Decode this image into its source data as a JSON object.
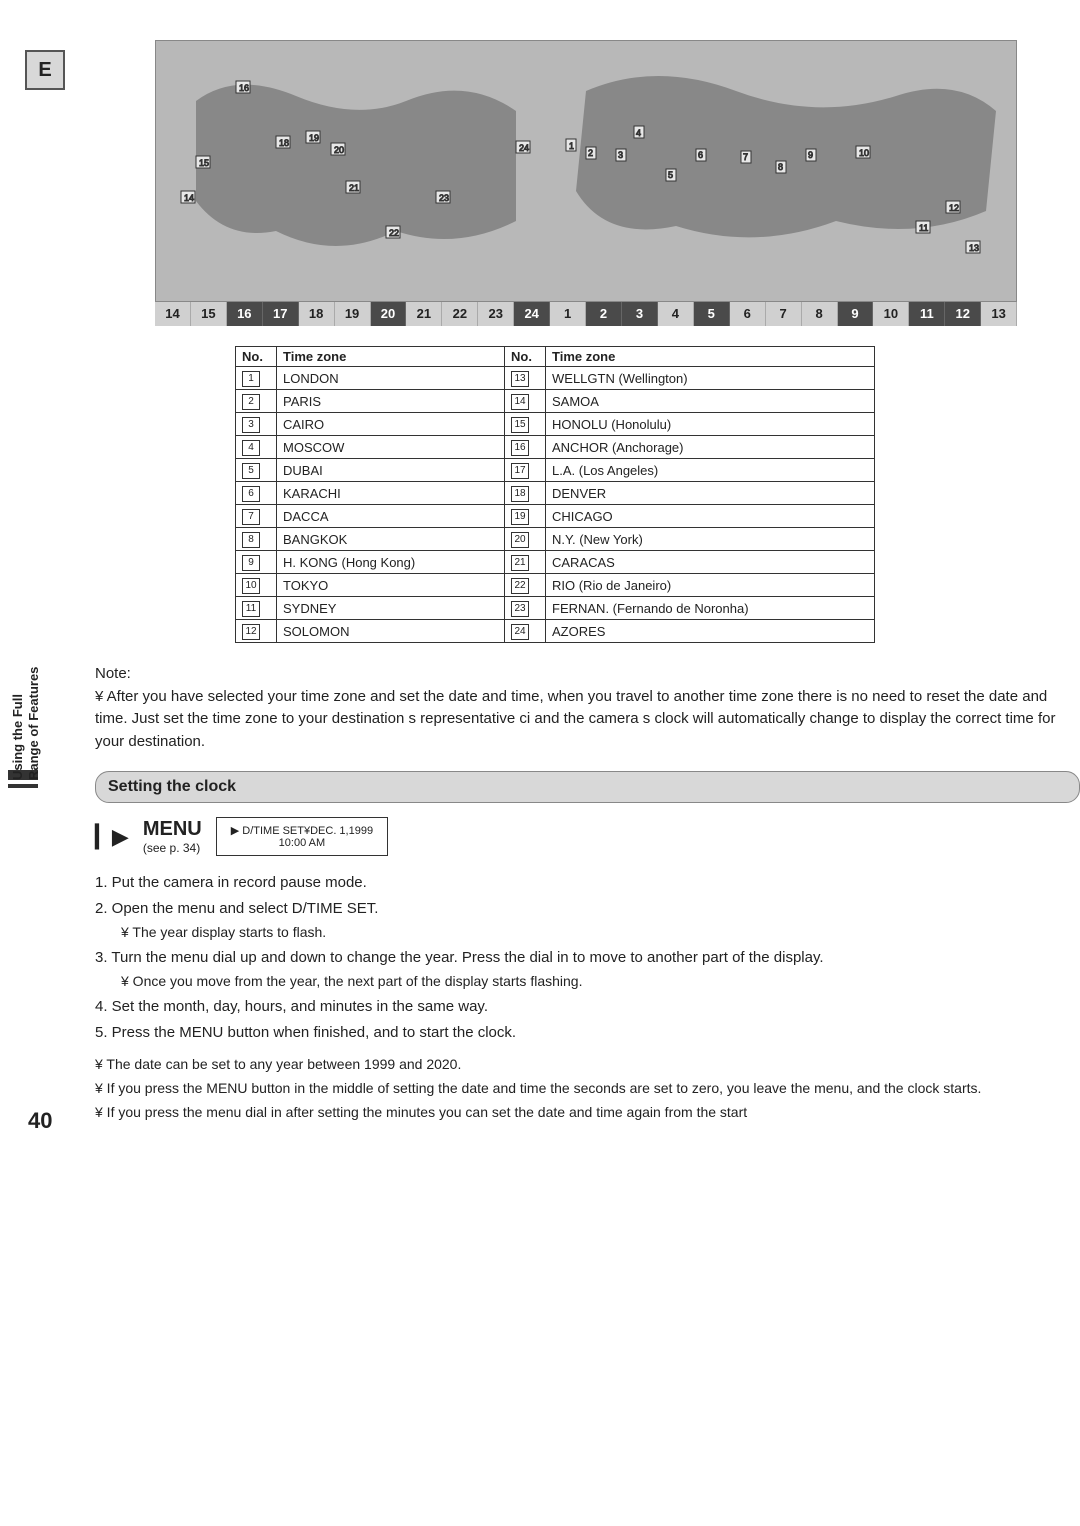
{
  "side_tab": "E",
  "side_label_line1": "Using the Full",
  "side_label_line2": "Range of Features",
  "time_strip": [
    "14",
    "15",
    "16",
    "17",
    "18",
    "19",
    "20",
    "21",
    "22",
    "23",
    "24",
    "1",
    "2",
    "3",
    "4",
    "5",
    "6",
    "7",
    "8",
    "9",
    "10",
    "11",
    "12",
    "13"
  ],
  "time_strip_dark": [
    2,
    3,
    6,
    10,
    12,
    13,
    15,
    19,
    21,
    22
  ],
  "tz_header": {
    "no": "No.",
    "zone": "Time zone"
  },
  "timezones_left": [
    {
      "n": "1",
      "name": "LONDON"
    },
    {
      "n": "2",
      "name": "PARIS"
    },
    {
      "n": "3",
      "name": "CAIRO"
    },
    {
      "n": "4",
      "name": "MOSCOW"
    },
    {
      "n": "5",
      "name": "DUBAI"
    },
    {
      "n": "6",
      "name": "KARACHI"
    },
    {
      "n": "7",
      "name": "DACCA"
    },
    {
      "n": "8",
      "name": "BANGKOK"
    },
    {
      "n": "9",
      "name": "H. KONG (Hong Kong)"
    },
    {
      "n": "10",
      "name": "TOKYO"
    },
    {
      "n": "11",
      "name": "SYDNEY"
    },
    {
      "n": "12",
      "name": "SOLOMON"
    }
  ],
  "timezones_right": [
    {
      "n": "13",
      "name": "WELLGTN (Wellington)"
    },
    {
      "n": "14",
      "name": "SAMOA"
    },
    {
      "n": "15",
      "name": "HONOLU (Honolulu)"
    },
    {
      "n": "16",
      "name": "ANCHOR (Anchorage)"
    },
    {
      "n": "17",
      "name": "L.A. (Los Angeles)"
    },
    {
      "n": "18",
      "name": "DENVER"
    },
    {
      "n": "19",
      "name": "CHICAGO"
    },
    {
      "n": "20",
      "name": "N.Y. (New York)"
    },
    {
      "n": "21",
      "name": "CARACAS"
    },
    {
      "n": "22",
      "name": "RIO (Rio de Janeiro)"
    },
    {
      "n": "23",
      "name": "FERNAN. (Fernando de Noronha)"
    },
    {
      "n": "24",
      "name": "AZORES"
    }
  ],
  "note_head": "Note:",
  "note_body": "¥ After you have selected your time zone and set the date and time, when you travel to another time zone there is no need to reset the date and time. Just set the time zone to your destination s representative ci and the camera s clock will automatically change to display the correct time for your destination.",
  "section_title": "Setting the clock",
  "menu": {
    "label": "MENU",
    "see": "(see p. 34)"
  },
  "lcd": {
    "line1": "▶ D/TIME SET¥DEC. 1,1999",
    "line2": "10:00 AM"
  },
  "steps": [
    "1.  Put the camera in record pause mode.",
    "2.  Open the menu and select D/TIME SET.",
    "3.  Turn the menu dial up and down to change the year. Press the dial in to move to another part of the display.",
    "4.  Set the month, day, hours, and minutes in the same way.",
    "5.  Press the MENU button when finished, and to start the clock."
  ],
  "sub2": "¥ The year display starts to flash.",
  "sub3": "¥ Once you move from the year, the next part of the display starts flashing.",
  "bullets": [
    "¥ The date can be set to any year between 1999 and 2020.",
    "¥ If you press the MENU button in the middle of setting the date and time the seconds are set to zero, you leave the menu, and the clock starts.",
    "¥ If you press the menu dial in after setting the minutes you can set the date and time again from the start"
  ],
  "page_number": "40"
}
